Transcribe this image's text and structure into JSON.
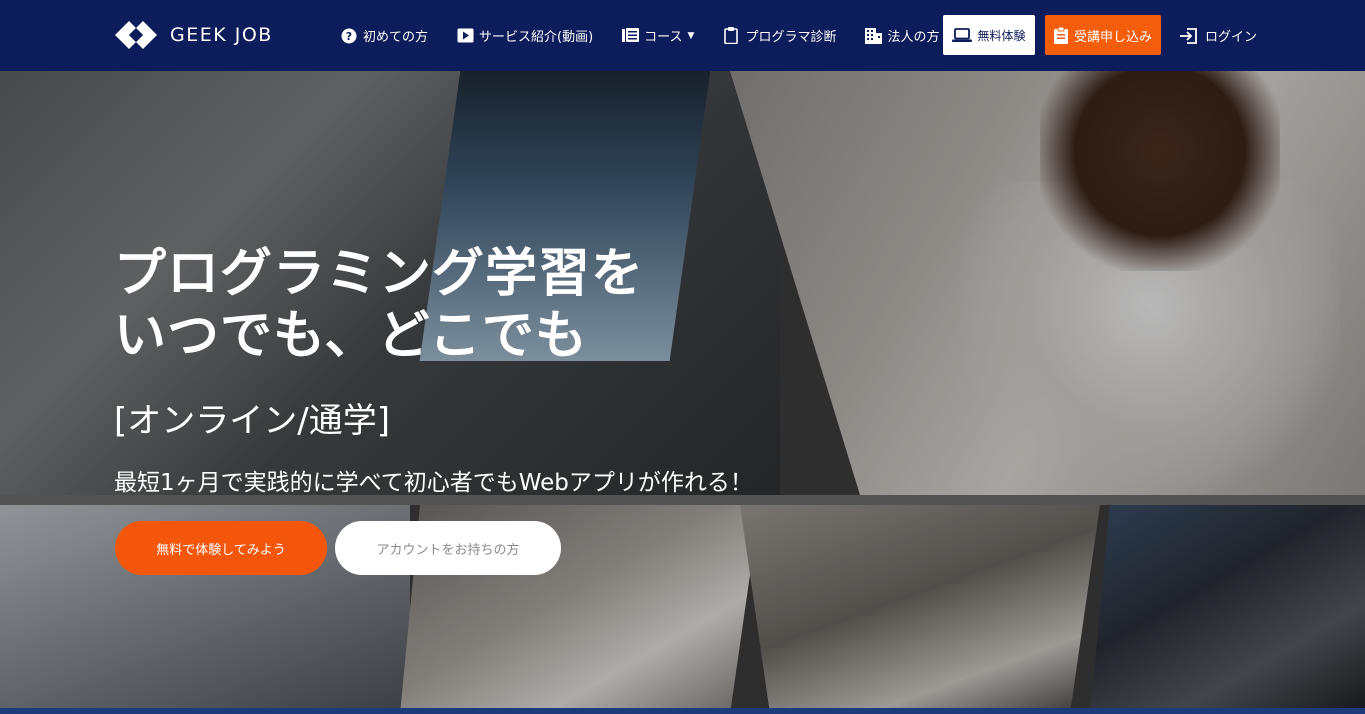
{
  "brand": {
    "name": "GEEK JOB"
  },
  "nav": [
    {
      "label": "初めての方",
      "icon": "question-circle-icon"
    },
    {
      "label": "サービス紹介(動画)",
      "icon": "play-icon"
    },
    {
      "label": "コース",
      "icon": "book-icon",
      "dropdown": true
    },
    {
      "label": "プログラマ診断",
      "icon": "clipboard-icon"
    },
    {
      "label": "法人の方",
      "icon": "building-icon"
    }
  ],
  "header_buttons": {
    "trial_label": "無料体験",
    "apply_label": "受講申し込み",
    "login_label": "ログイン"
  },
  "hero": {
    "headline_line1": "プログラミング学習を",
    "headline_line2": "いつでも、どこでも",
    "mode": "[オンライン/通学]",
    "tagline": "最短1ヶ月で実践的に学べて初心者でもWebアプリが作れる！",
    "cta_primary": "無料で体験してみよう",
    "cta_secondary": "アカウントをお持ちの方"
  },
  "colors": {
    "header_bg": "#0d1c5a",
    "accent_orange": "#f45d0c",
    "white": "#ffffff"
  }
}
